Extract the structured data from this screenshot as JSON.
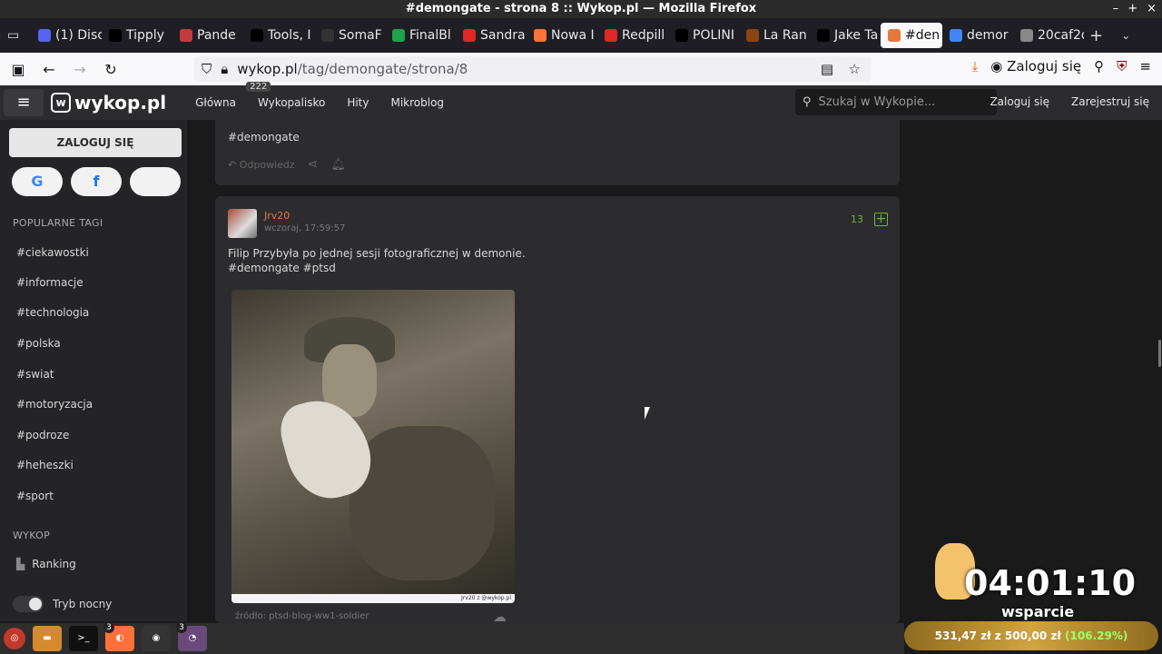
{
  "window": {
    "title": "#demongate - strona 8 :: Wykop.pl — Mozilla Firefox"
  },
  "tabs": [
    {
      "label": "(1) Disc",
      "color": "#5865f2"
    },
    {
      "label": "Tipply",
      "color": "#000000"
    },
    {
      "label": "Pande",
      "color": "#c03b3b"
    },
    {
      "label": "Tools, I",
      "color": "#000000"
    },
    {
      "label": "SomaF",
      "color": "#333333"
    },
    {
      "label": "FinalBl",
      "color": "#1da34b"
    },
    {
      "label": "Sandra",
      "color": "#e02626"
    },
    {
      "label": "Nowa I",
      "color": "#ff7139"
    },
    {
      "label": "Redpill",
      "color": "#e02626"
    },
    {
      "label": "POLINI",
      "color": "#000000"
    },
    {
      "label": "La Ran",
      "color": "#8b4513"
    },
    {
      "label": "Jake Ta",
      "color": "#000000"
    },
    {
      "label": "#den",
      "color": "#e5793b"
    },
    {
      "label": "demor",
      "color": "#4285f4"
    },
    {
      "label": "20caf2da",
      "color": "#888888"
    }
  ],
  "url": {
    "host": "wykop.pl",
    "path": "/tag/demongate/strona/8"
  },
  "browser": {
    "login_label": "Zaloguj się"
  },
  "site": {
    "logo": "wykop.pl",
    "menu": [
      "Główna",
      "Wykopalisko",
      "Hity",
      "Mikroblog"
    ],
    "wykopalisko_count": "222",
    "search_placeholder": "Szukaj w Wykopie...",
    "login": "Zaloguj się",
    "register": "Zarejestruj się"
  },
  "sidebar": {
    "login_button": "ZALOGUJ SIĘ",
    "popular_title": "POPULARNE TAGI",
    "tags": [
      "#ciekawostki",
      "#informacje",
      "#technologia",
      "#polska",
      "#swiat",
      "#motoryzacja",
      "#podroze",
      "#heheszki",
      "#sport"
    ],
    "wykop_title": "WYKOP",
    "ranking": "Ranking",
    "night_mode": "Tryb nocny"
  },
  "prev_post": {
    "tag": "#demongate",
    "reply": "Odpowiedz"
  },
  "post": {
    "author": "Jrv20",
    "time": "wczoraj, 17:59:57",
    "votes": "13",
    "text_line1": "Filip Przybyła po jednej sesji fotograficznej w demonie.",
    "text_line2": "#demongate #ptsd",
    "source": "źródło: ptsd-blog-ww1-soldier",
    "image_footer": "Jrv20 z @wykop.pl"
  },
  "overlay": {
    "timer": "04:01:10",
    "label": "wsparcie",
    "donation_amount": "531,47 zł",
    "donation_mid": "z",
    "donation_goal": "500,00 zł",
    "donation_pct": "(106.29%)"
  }
}
